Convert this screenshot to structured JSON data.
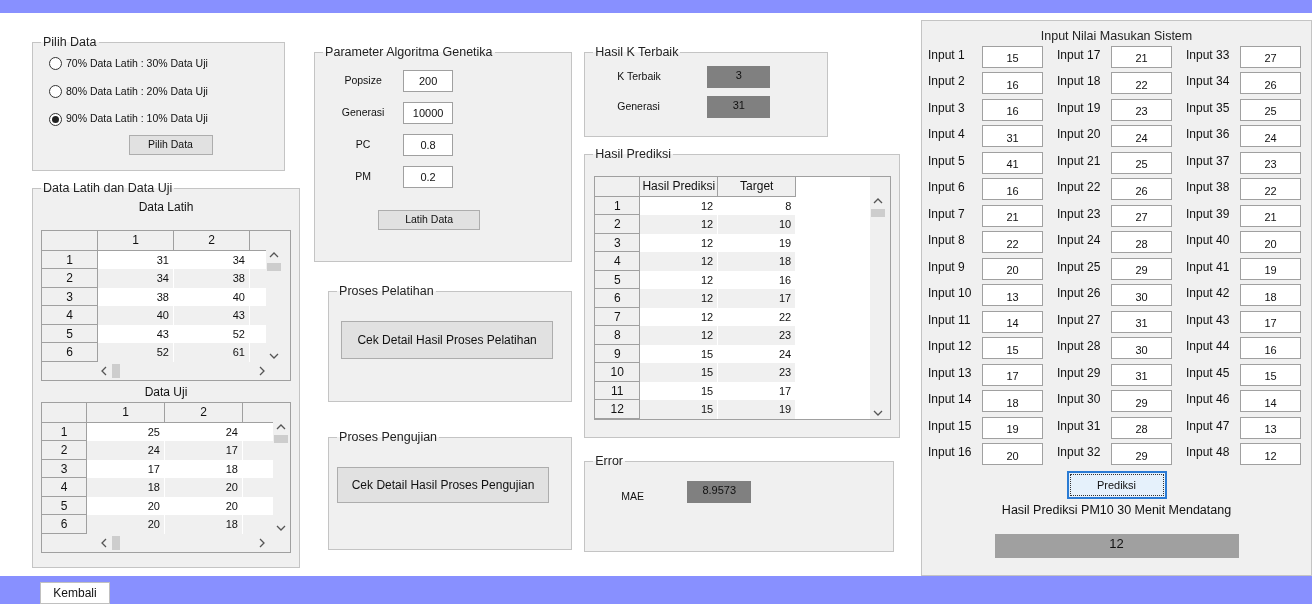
{
  "pilih_data": {
    "title": "Pilih Data",
    "options": [
      {
        "label": "70% Data Latih : 30% Data Uji",
        "selected": false
      },
      {
        "label": "80% Data Latih : 20% Data Uji",
        "selected": false
      },
      {
        "label": "90% Data Latih : 10% Data Uji",
        "selected": true
      }
    ],
    "button": "Pilih Data"
  },
  "data_panel": {
    "title": "Data Latih dan Data Uji",
    "tables": [
      {
        "title": "Data Latih",
        "columns": [
          "1",
          "2"
        ],
        "rows": [
          {
            "header": "1",
            "cells": [
              "31",
              "34"
            ]
          },
          {
            "header": "2",
            "cells": [
              "34",
              "38"
            ]
          },
          {
            "header": "3",
            "cells": [
              "38",
              "40"
            ]
          },
          {
            "header": "4",
            "cells": [
              "40",
              "43"
            ]
          },
          {
            "header": "5",
            "cells": [
              "43",
              "52"
            ]
          },
          {
            "header": "6",
            "cells": [
              "52",
              "61"
            ]
          }
        ]
      },
      {
        "title": "Data Uji",
        "columns": [
          "1",
          "2"
        ],
        "rows": [
          {
            "header": "1",
            "cells": [
              "25",
              "24"
            ]
          },
          {
            "header": "2",
            "cells": [
              "24",
              "17"
            ]
          },
          {
            "header": "3",
            "cells": [
              "17",
              "18"
            ]
          },
          {
            "header": "4",
            "cells": [
              "18",
              "20"
            ]
          },
          {
            "header": "5",
            "cells": [
              "20",
              "20"
            ]
          },
          {
            "header": "6",
            "cells": [
              "20",
              "18"
            ]
          }
        ]
      }
    ]
  },
  "parameter": {
    "title": "Parameter Algoritma Genetika",
    "fields": [
      {
        "label": "Popsize",
        "value": "200"
      },
      {
        "label": "Generasi",
        "value": "10000"
      },
      {
        "label": "PC",
        "value": "0.8"
      },
      {
        "label": "PM",
        "value": "0.2"
      }
    ],
    "button": "Latih Data"
  },
  "proses_pelatihan": {
    "title": "Proses Pelatihan",
    "button": "Cek Detail Hasil Proses Pelatihan"
  },
  "proses_pengujian": {
    "title": "Proses Pengujian",
    "button": "Cek Detail Hasil Proses Pengujian"
  },
  "hasil_k": {
    "title": "Hasil K Terbaik",
    "fields": [
      {
        "label": "K Terbaik",
        "value": "3"
      },
      {
        "label": "Generasi",
        "value": "31"
      }
    ]
  },
  "hasil_prediksi": {
    "title": "Hasil Prediksi",
    "columns": [
      "Hasil Prediksi",
      "Target"
    ],
    "rows": [
      {
        "header": "1",
        "cells": [
          "12",
          "8"
        ]
      },
      {
        "header": "2",
        "cells": [
          "12",
          "10"
        ]
      },
      {
        "header": "3",
        "cells": [
          "12",
          "19"
        ]
      },
      {
        "header": "4",
        "cells": [
          "12",
          "18"
        ]
      },
      {
        "header": "5",
        "cells": [
          "12",
          "16"
        ]
      },
      {
        "header": "6",
        "cells": [
          "12",
          "17"
        ]
      },
      {
        "header": "7",
        "cells": [
          "12",
          "22"
        ]
      },
      {
        "header": "8",
        "cells": [
          "12",
          "23"
        ]
      },
      {
        "header": "9",
        "cells": [
          "15",
          "24"
        ]
      },
      {
        "header": "10",
        "cells": [
          "15",
          "23"
        ]
      },
      {
        "header": "11",
        "cells": [
          "15",
          "17"
        ]
      },
      {
        "header": "12",
        "cells": [
          "15",
          "19"
        ]
      }
    ]
  },
  "error": {
    "title": "Error",
    "fields": [
      {
        "label": "MAE",
        "value": "8.9573"
      }
    ]
  },
  "input_panel": {
    "title": "Input Nilai Masukan Sistem",
    "columns": [
      [
        {
          "label": "Input 1",
          "value": "15"
        },
        {
          "label": "Input 2",
          "value": "16"
        },
        {
          "label": "Input 3",
          "value": "16"
        },
        {
          "label": "Input 4",
          "value": "31"
        },
        {
          "label": "Input 5",
          "value": "41"
        },
        {
          "label": "Input 6",
          "value": "16"
        },
        {
          "label": "Input 7",
          "value": "21"
        },
        {
          "label": "Input 8",
          "value": "22"
        },
        {
          "label": "Input 9",
          "value": "20"
        },
        {
          "label": "Input 10",
          "value": "13"
        },
        {
          "label": "Input 11",
          "value": "14"
        },
        {
          "label": "Input 12",
          "value": "15"
        },
        {
          "label": "Input 13",
          "value": "17"
        },
        {
          "label": "Input 14",
          "value": "18"
        },
        {
          "label": "Input 15",
          "value": "19"
        },
        {
          "label": "Input 16",
          "value": "20"
        }
      ],
      [
        {
          "label": "Input 17",
          "value": "21"
        },
        {
          "label": "Input 18",
          "value": "22"
        },
        {
          "label": "Input 19",
          "value": "23"
        },
        {
          "label": "Input 20",
          "value": "24"
        },
        {
          "label": "Input 21",
          "value": "25"
        },
        {
          "label": "Input 22",
          "value": "26"
        },
        {
          "label": "Input 23",
          "value": "27"
        },
        {
          "label": "Input 24",
          "value": "28"
        },
        {
          "label": "Input 25",
          "value": "29"
        },
        {
          "label": "Input 26",
          "value": "30"
        },
        {
          "label": "Input 27",
          "value": "31"
        },
        {
          "label": "Input 28",
          "value": "30"
        },
        {
          "label": "Input 29",
          "value": "31"
        },
        {
          "label": "Input 30",
          "value": "29"
        },
        {
          "label": "Input 31",
          "value": "28"
        },
        {
          "label": "Input 32",
          "value": "29"
        }
      ],
      [
        {
          "label": "Input 33",
          "value": "27"
        },
        {
          "label": "Input 34",
          "value": "26"
        },
        {
          "label": "Input 35",
          "value": "25"
        },
        {
          "label": "Input 36",
          "value": "24"
        },
        {
          "label": "Input 37",
          "value": "23"
        },
        {
          "label": "Input 38",
          "value": "22"
        },
        {
          "label": "Input 39",
          "value": "21"
        },
        {
          "label": "Input 40",
          "value": "20"
        },
        {
          "label": "Input 41",
          "value": "19"
        },
        {
          "label": "Input 42",
          "value": "18"
        },
        {
          "label": "Input 43",
          "value": "17"
        },
        {
          "label": "Input 44",
          "value": "16"
        },
        {
          "label": "Input 45",
          "value": "15"
        },
        {
          "label": "Input 46",
          "value": "14"
        },
        {
          "label": "Input 47",
          "value": "13"
        },
        {
          "label": "Input 48",
          "value": "12"
        }
      ]
    ],
    "button": "Prediksi",
    "result_label": "Hasil Prediksi PM10 30 Menit Mendatang",
    "result": "12"
  },
  "footer": {
    "button": "Kembali"
  }
}
